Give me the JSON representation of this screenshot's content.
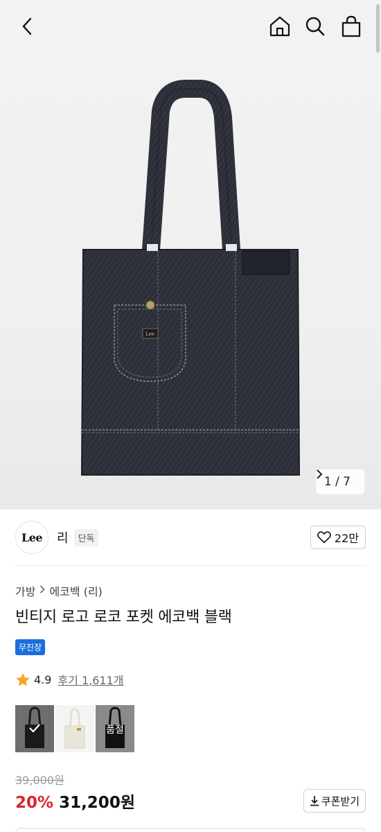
{
  "header": {
    "back_icon": "chevron-left-icon",
    "home_icon": "home-icon",
    "search_icon": "search-icon",
    "cart_icon": "shopping-bag-icon"
  },
  "gallery": {
    "counter": "1 / 7",
    "next_icon": "chevron-right-icon"
  },
  "brand": {
    "logo_text": "Lee",
    "name": "리",
    "badge": "단독",
    "like_icon": "heart-icon",
    "like_count": "22만"
  },
  "breadcrumb": {
    "category": "가방",
    "subcategory": "에코백 (리)"
  },
  "product": {
    "title": "빈티지 로고 로코 포켓 에코백 블랙",
    "shipping_badge": "무진장",
    "rating": "4.9",
    "reviews": "후기 1,611개",
    "options": [
      {
        "label": "",
        "selected": true
      },
      {
        "label": ""
      },
      {
        "label": "품절"
      }
    ],
    "original_price": "39,000원",
    "discount": "20%",
    "price": "31,200원",
    "coupon_label": "쿠폰받기"
  },
  "colors": {
    "accent_blue": "#1a6fdc",
    "discount_red": "#e0232e",
    "star": "#f5a623"
  }
}
